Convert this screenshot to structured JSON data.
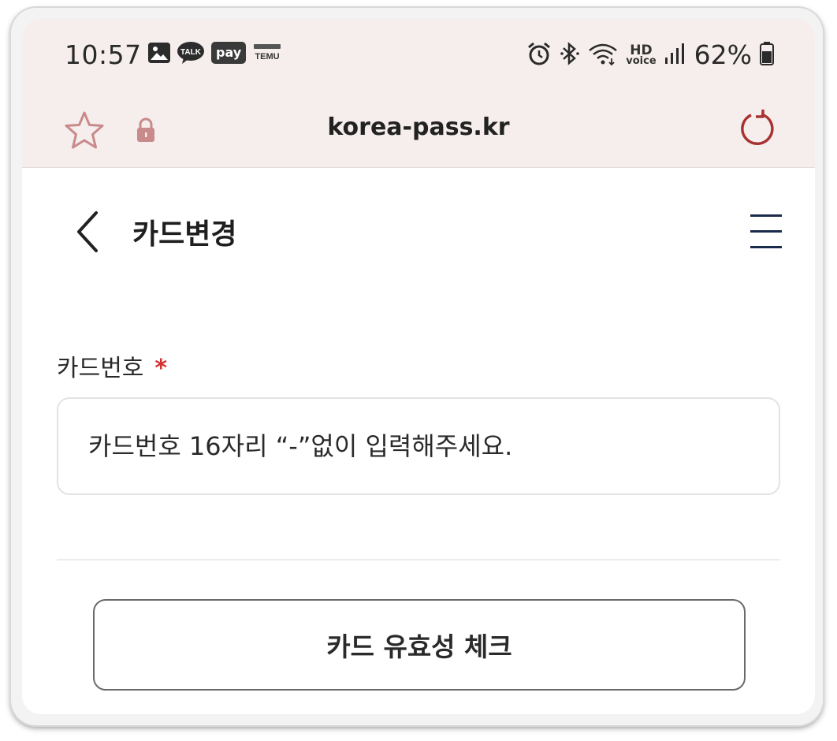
{
  "status_bar": {
    "time": "10:57",
    "notification_icons": [
      "gallery-icon",
      "kakaotalk-icon",
      "pay-icon",
      "temu-icon"
    ],
    "talk_label": "TALK",
    "pay_label": "pay",
    "temu_label": "TEMU",
    "system_icons": [
      "alarm-icon",
      "bluetooth-icon",
      "wifi-icon",
      "hd-voice-icon",
      "signal-icon",
      "battery-icon"
    ],
    "hd_label": "HD",
    "voice_label": "voice",
    "battery_percent": "62%"
  },
  "browser": {
    "url": "korea-pass.kr",
    "bookmark_icon": "star-icon",
    "secure_icon": "lock-icon",
    "reload_icon": "reload-icon",
    "accent_color": "#b03a3a"
  },
  "header": {
    "title": "카드변경",
    "back_icon": "chevron-left-icon",
    "menu_icon": "hamburger-menu-icon"
  },
  "form": {
    "card_number_label": "카드번호",
    "required_mark": "*",
    "card_number_placeholder": "카드번호 16자리 “-”없이 입력해주세요.",
    "card_number_value": "",
    "check_button_label": "카드 유효성 체크"
  }
}
